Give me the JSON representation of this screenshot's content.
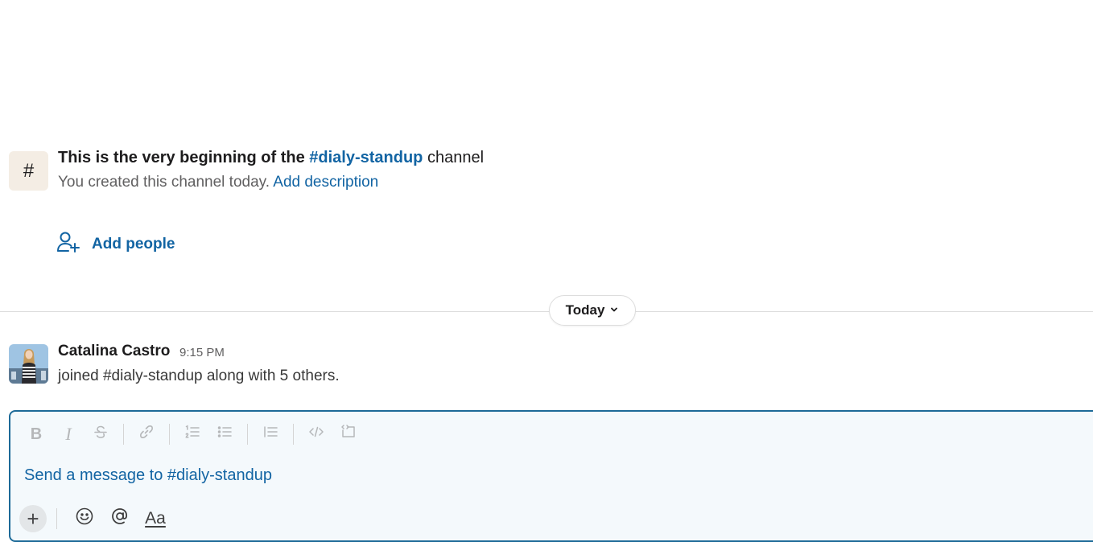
{
  "intro": {
    "hash_icon": "#",
    "title_prefix": "This is the very beginning of the",
    "channel_link": "#dialy-standup",
    "title_suffix": "channel",
    "subtitle": "You created this channel today.",
    "add_description": "Add description",
    "add_people": "Add people"
  },
  "divider": {
    "label": "Today"
  },
  "message": {
    "author": "Catalina Castro",
    "time": "9:15 PM",
    "text": "joined #dialy-standup along with 5 others."
  },
  "composer": {
    "placeholder": "Send a message to #dialy-standup",
    "toolbar": {
      "bold": "B",
      "italic": "I"
    },
    "format_label": "Aa",
    "plus": "+"
  },
  "colors": {
    "link": "#1264a3",
    "composer_border": "#1d6a98",
    "hash_bg": "#f4ede4"
  }
}
